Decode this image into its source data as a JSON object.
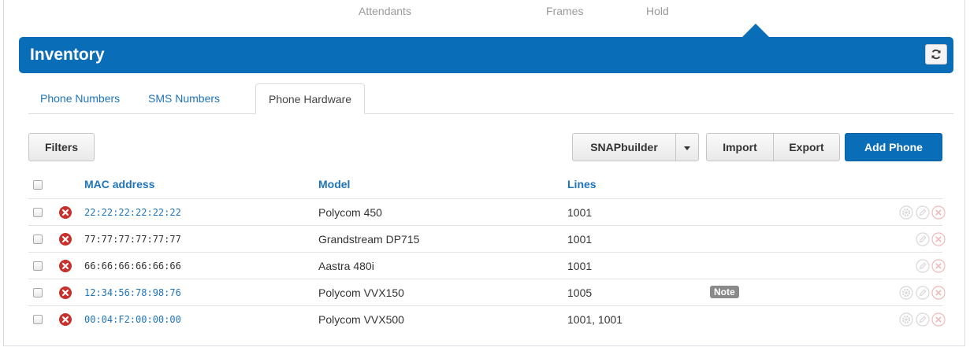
{
  "topnav": {
    "attendants": "Attendants",
    "frames": "Frames",
    "hold": "Hold"
  },
  "header": {
    "title": "Inventory",
    "refresh_icon": "refresh-icon"
  },
  "tabs": [
    {
      "label": "Phone Numbers",
      "active": false
    },
    {
      "label": "SMS Numbers",
      "active": false
    },
    {
      "label": "Phone Hardware",
      "active": true
    }
  ],
  "toolbar": {
    "filters_label": "Filters",
    "snapbuilder_label": "SNAPbuilder",
    "import_label": "Import",
    "export_label": "Export",
    "add_phone_label": "Add Phone"
  },
  "table": {
    "columns": [
      "MAC address",
      "Model",
      "Lines"
    ],
    "rows": [
      {
        "mac": "22:22:22:22:22:22",
        "mac_is_link": true,
        "model": "Polycom 450",
        "lines": "1001",
        "note": "",
        "actions": [
          "gear-icon",
          "edit-icon",
          "delete-icon"
        ]
      },
      {
        "mac": "77:77:77:77:77:77",
        "mac_is_link": false,
        "model": "Grandstream DP715",
        "lines": "1001",
        "note": "",
        "actions": [
          "edit-icon",
          "delete-icon"
        ]
      },
      {
        "mac": "66:66:66:66:66:66",
        "mac_is_link": false,
        "model": "Aastra 480i",
        "lines": "1001",
        "note": "",
        "actions": [
          "edit-icon",
          "delete-icon"
        ]
      },
      {
        "mac": "12:34:56:78:98:76",
        "mac_is_link": true,
        "model": "Polycom VVX150",
        "lines": "1005",
        "note": "Note",
        "actions": [
          "gear-icon",
          "edit-icon",
          "delete-icon"
        ]
      },
      {
        "mac": "00:04:F2:00:00:00",
        "mac_is_link": true,
        "model": "Polycom VVX500",
        "lines": "1001, 1001",
        "note": "",
        "actions": [
          "gear-icon",
          "edit-icon",
          "delete-icon"
        ]
      }
    ]
  },
  "colors": {
    "brand_blue": "#0a6db8",
    "link_blue": "#1e74bb",
    "error_red": "#c9302c",
    "muted_action": "#d8d8d8",
    "delete_faded": "#f2b8b8"
  }
}
